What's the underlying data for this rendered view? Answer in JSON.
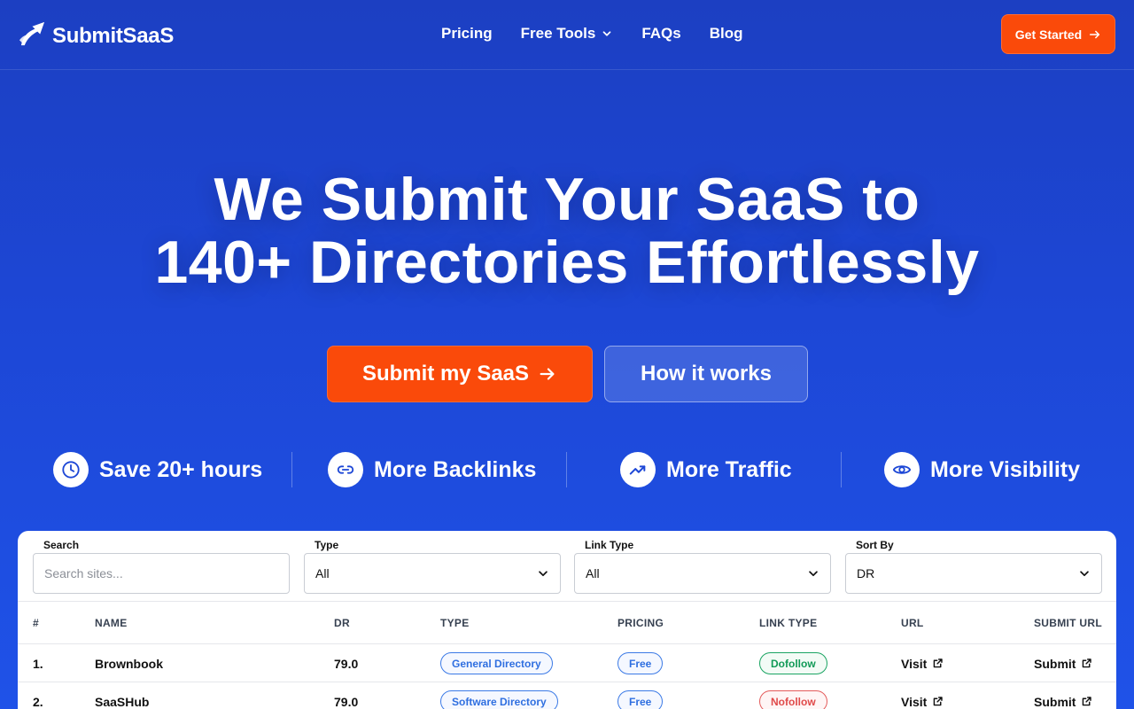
{
  "brand": {
    "name": "SubmitSaaS",
    "logo_icon": "rocket-arrow-icon"
  },
  "nav": {
    "links": [
      {
        "label": "Pricing"
      },
      {
        "label": "Free Tools",
        "icon": "chevron-down-icon"
      },
      {
        "label": "FAQs"
      },
      {
        "label": "Blog"
      }
    ],
    "cta": "Get Started"
  },
  "hero": {
    "title_line1": "We Submit Your SaaS to",
    "title_line2": "140+ Directories Effortlessly",
    "primary_cta": "Submit my SaaS",
    "secondary_cta": "How it works"
  },
  "features": [
    {
      "label": "Save 20+ hours",
      "icon": "clock-icon"
    },
    {
      "label": "More Backlinks",
      "icon": "link-icon"
    },
    {
      "label": "More Traffic",
      "icon": "trending-up-icon"
    },
    {
      "label": "More Visibility",
      "icon": "eye-icon"
    }
  ],
  "filters": {
    "search": {
      "label": "Search",
      "placeholder": "Search sites..."
    },
    "type": {
      "label": "Type",
      "value": "All"
    },
    "link_type": {
      "label": "Link Type",
      "value": "All"
    },
    "sort_by": {
      "label": "Sort By",
      "value": "DR"
    }
  },
  "table": {
    "columns": [
      "#",
      "NAME",
      "DR",
      "TYPE",
      "PRICING",
      "LINK TYPE",
      "URL",
      "SUBMIT URL"
    ],
    "rows": [
      {
        "num": "1.",
        "name": "Brownbook",
        "dr": "79.0",
        "type": "General Directory",
        "pricing": "Free",
        "link_type": "Dofollow",
        "url": "Visit",
        "submit": "Submit"
      },
      {
        "num": "2.",
        "name": "SaaSHub",
        "dr": "79.0",
        "type": "Software Directory",
        "pricing": "Free",
        "link_type": "Nofollow",
        "url": "Visit",
        "submit": "Submit"
      }
    ]
  },
  "colors": {
    "accent": "#fa4a0a",
    "background": "#1d47d6",
    "dofollow": "#119a57",
    "nofollow": "#e04a4a",
    "pill_blue": "#2f6fe0"
  }
}
